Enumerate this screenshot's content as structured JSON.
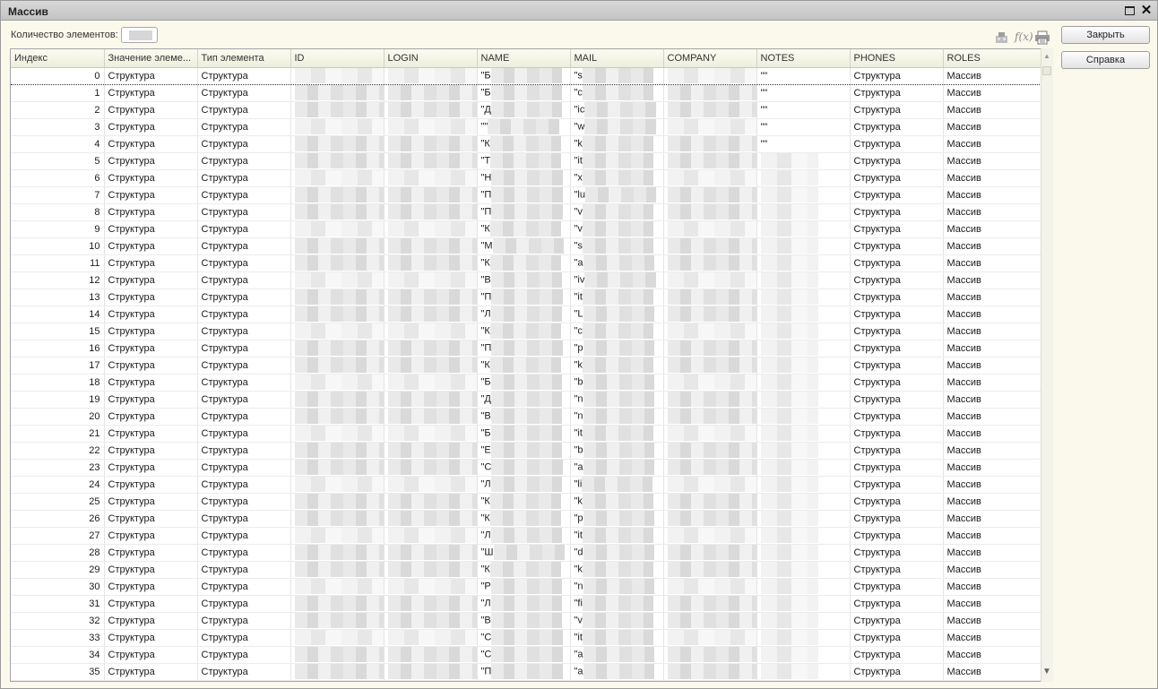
{
  "window": {
    "title": "Массив"
  },
  "count": {
    "label": "Количество элементов:"
  },
  "toolbar": {
    "formula_icon_text": "f(x)"
  },
  "buttons": {
    "close_label": "Закрыть",
    "help_label": "Справка"
  },
  "columns": [
    "Индекс",
    "Значение элеме...",
    "Тип элемента",
    "ID",
    "LOGIN",
    "NAME",
    "MAIL",
    "COMPANY",
    "NOTES",
    "PHONES",
    "ROLES"
  ],
  "rows": [
    {
      "idx": "0",
      "value": "Структура",
      "type": "Структура",
      "name": "\"Б",
      "mail": "\"s",
      "notes": "\"\"",
      "phones": "Структура",
      "roles": "Массив"
    },
    {
      "idx": "1",
      "value": "Структура",
      "type": "Структура",
      "name": "\"Б",
      "mail": "\"c",
      "notes": "\"\"",
      "phones": "Структура",
      "roles": "Массив"
    },
    {
      "idx": "2",
      "value": "Структура",
      "type": "Структура",
      "name": "\"Д",
      "mail": "\"ic",
      "notes": "\"\"",
      "phones": "Структура",
      "roles": "Массив"
    },
    {
      "idx": "3",
      "value": "Структура",
      "type": "Структура",
      "name": "\"\"",
      "mail": "\"w",
      "notes": "\"\"",
      "phones": "Структура",
      "roles": "Массив"
    },
    {
      "idx": "4",
      "value": "Структура",
      "type": "Структура",
      "name": "\"К",
      "mail": "\"k",
      "notes": "\"\"",
      "phones": "Структура",
      "roles": "Массив"
    },
    {
      "idx": "5",
      "value": "Структура",
      "type": "Структура",
      "name": "\"Т",
      "mail": "\"it",
      "notes": "",
      "phones": "Структура",
      "roles": "Массив"
    },
    {
      "idx": "6",
      "value": "Структура",
      "type": "Структура",
      "name": "\"Н",
      "mail": "\"x",
      "notes": "",
      "phones": "Структура",
      "roles": "Массив"
    },
    {
      "idx": "7",
      "value": "Структура",
      "type": "Структура",
      "name": "\"П",
      "mail": "\"lu",
      "notes": "",
      "phones": "Структура",
      "roles": "Массив"
    },
    {
      "idx": "8",
      "value": "Структура",
      "type": "Структура",
      "name": "\"П",
      "mail": "\"v",
      "notes": "",
      "phones": "Структура",
      "roles": "Массив"
    },
    {
      "idx": "9",
      "value": "Структура",
      "type": "Структура",
      "name": "\"К",
      "mail": "\"v",
      "notes": "",
      "phones": "Структура",
      "roles": "Массив"
    },
    {
      "idx": "10",
      "value": "Структура",
      "type": "Структура",
      "name": "\"М",
      "mail": "\"s",
      "notes": "",
      "phones": "Структура",
      "roles": "Массив"
    },
    {
      "idx": "11",
      "value": "Структура",
      "type": "Структура",
      "name": "\"К",
      "mail": "\"a",
      "notes": "",
      "phones": "Структура",
      "roles": "Массив"
    },
    {
      "idx": "12",
      "value": "Структура",
      "type": "Структура",
      "name": "\"В",
      "mail": "\"iv",
      "notes": "",
      "phones": "Структура",
      "roles": "Массив"
    },
    {
      "idx": "13",
      "value": "Структура",
      "type": "Структура",
      "name": "\"П",
      "mail": "\"it",
      "notes": "",
      "phones": "Структура",
      "roles": "Массив"
    },
    {
      "idx": "14",
      "value": "Структура",
      "type": "Структура",
      "name": "\"Л",
      "mail": "\"L",
      "notes": "",
      "phones": "Структура",
      "roles": "Массив"
    },
    {
      "idx": "15",
      "value": "Структура",
      "type": "Структура",
      "name": "\"К",
      "mail": "\"c",
      "notes": "",
      "phones": "Структура",
      "roles": "Массив"
    },
    {
      "idx": "16",
      "value": "Структура",
      "type": "Структура",
      "name": "\"П",
      "mail": "\"p",
      "notes": "",
      "phones": "Структура",
      "roles": "Массив"
    },
    {
      "idx": "17",
      "value": "Структура",
      "type": "Структура",
      "name": "\"К",
      "mail": "\"k",
      "notes": "",
      "phones": "Структура",
      "roles": "Массив"
    },
    {
      "idx": "18",
      "value": "Структура",
      "type": "Структура",
      "name": "\"Б",
      "mail": "\"b",
      "notes": "",
      "phones": "Структура",
      "roles": "Массив"
    },
    {
      "idx": "19",
      "value": "Структура",
      "type": "Структура",
      "name": "\"Д",
      "mail": "\"n",
      "notes": "",
      "phones": "Структура",
      "roles": "Массив"
    },
    {
      "idx": "20",
      "value": "Структура",
      "type": "Структура",
      "name": "\"В",
      "mail": "\"n",
      "notes": "",
      "phones": "Структура",
      "roles": "Массив"
    },
    {
      "idx": "21",
      "value": "Структура",
      "type": "Структура",
      "name": "\"Б",
      "mail": "\"it",
      "notes": "",
      "phones": "Структура",
      "roles": "Массив"
    },
    {
      "idx": "22",
      "value": "Структура",
      "type": "Структура",
      "name": "\"Е",
      "mail": "\"b",
      "notes": "",
      "phones": "Структура",
      "roles": "Массив"
    },
    {
      "idx": "23",
      "value": "Структура",
      "type": "Структура",
      "name": "\"С",
      "mail": "\"a",
      "notes": "",
      "phones": "Структура",
      "roles": "Массив"
    },
    {
      "idx": "24",
      "value": "Структура",
      "type": "Структура",
      "name": "\"Л",
      "mail": "\"li",
      "notes": "",
      "phones": "Структура",
      "roles": "Массив"
    },
    {
      "idx": "25",
      "value": "Структура",
      "type": "Структура",
      "name": "\"К",
      "mail": "\"k",
      "notes": "",
      "phones": "Структура",
      "roles": "Массив"
    },
    {
      "idx": "26",
      "value": "Структура",
      "type": "Структура",
      "name": "\"К",
      "mail": "\"p",
      "notes": "",
      "phones": "Структура",
      "roles": "Массив"
    },
    {
      "idx": "27",
      "value": "Структура",
      "type": "Структура",
      "name": "\"Л",
      "mail": "\"it",
      "notes": "",
      "phones": "Структура",
      "roles": "Массив"
    },
    {
      "idx": "28",
      "value": "Структура",
      "type": "Структура",
      "name": "\"Ш",
      "mail": "\"d",
      "notes": "",
      "phones": "Структура",
      "roles": "Массив"
    },
    {
      "idx": "29",
      "value": "Структура",
      "type": "Структура",
      "name": "\"К",
      "mail": "\"k",
      "notes": "",
      "phones": "Структура",
      "roles": "Массив"
    },
    {
      "idx": "30",
      "value": "Структура",
      "type": "Структура",
      "name": "\"Р",
      "mail": "\"n",
      "notes": "",
      "phones": "Структура",
      "roles": "Массив"
    },
    {
      "idx": "31",
      "value": "Структура",
      "type": "Структура",
      "name": "\"Л",
      "mail": "\"fi",
      "notes": "",
      "phones": "Структура",
      "roles": "Массив"
    },
    {
      "idx": "32",
      "value": "Структура",
      "type": "Структура",
      "name": "\"В",
      "mail": "\"v",
      "notes": "",
      "phones": "Структура",
      "roles": "Массив"
    },
    {
      "idx": "33",
      "value": "Структура",
      "type": "Структура",
      "name": "\"С",
      "mail": "\"it",
      "notes": "",
      "phones": "Структура",
      "roles": "Массив"
    },
    {
      "idx": "34",
      "value": "Структура",
      "type": "Структура",
      "name": "\"С",
      "mail": "\"a",
      "notes": "",
      "phones": "Структура",
      "roles": "Массив"
    },
    {
      "idx": "35",
      "value": "Структура",
      "type": "Структура",
      "name": "\"П",
      "mail": "\"a",
      "notes": "",
      "phones": "Структура",
      "roles": "Массив"
    }
  ]
}
